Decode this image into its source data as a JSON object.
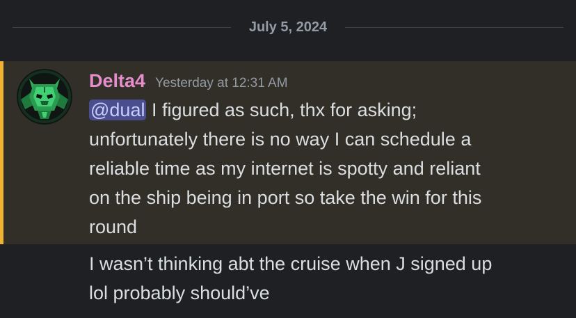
{
  "divider": {
    "date": "July 5, 2024"
  },
  "messages": [
    {
      "author": "Delta4",
      "timestamp": "Yesterday at 12:31 AM",
      "mention": "@dual",
      "lines": [
        "I figured as such, thx for asking;",
        "unfortunately there is no way I can schedule a",
        "reliable time as my internet is spotty and reliant",
        "on the ship being in port so take the win for this",
        "round"
      ],
      "author_color": "#e58ecb",
      "highlight_bar_color": "#f0b232"
    },
    {
      "lines": [
        "I wasn’t thinking abt the cruise when J signed up",
        "lol probably should’ve"
      ]
    }
  ]
}
